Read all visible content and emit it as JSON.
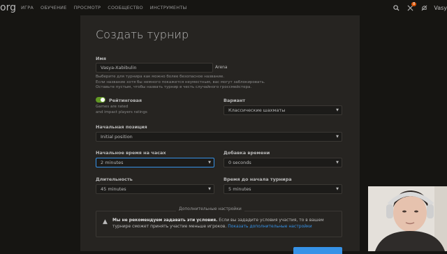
{
  "header": {
    "logo": "org",
    "nav": [
      "ИГРА",
      "ОБУЧЕНИЕ",
      "ПРОСМОТР",
      "СООБЩЕСТВО",
      "ИНСТРУМЕНТЫ"
    ],
    "badge_count": "8",
    "username": "Vasy"
  },
  "form": {
    "title": "Создать турнир",
    "name_label": "Имя",
    "name_value": "Vasya-Xabibulin",
    "name_suffix": "Arena",
    "name_hint": [
      "Выберите для турнира как можно более безопасное название.",
      "Если название хотя бы немного покажется неуместным, вас могут заблокировать.",
      "Оставьте пустым, чтобы назвать турнир в честь случайного гроссмейстера."
    ],
    "rated_label": "Рейтинговая",
    "rated_hint": [
      "Games are rated",
      "and impact players ratings"
    ],
    "variant_label": "Вариант",
    "variant_value": "Классические шахматы",
    "position_label": "Начальная позиция",
    "position_value": "Initial position",
    "clock_label": "Начальное время на часах",
    "clock_value": "2 minutes",
    "increment_label": "Добавка времени",
    "increment_value": "0 seconds",
    "duration_label": "Длительность",
    "duration_value": "45 minutes",
    "start_label": "Время до начала турнира",
    "start_value": "5 minutes",
    "advanced_legend": "Дополнительные настройки",
    "warning_bold": "Мы не рекомендуем задавать эти условия.",
    "warning_text": " Если вы зададите условия участия, то в вашем турнире сможет принять участие меньше игроков. ",
    "warning_link": "Показать дополнительные настройки"
  },
  "colors": {
    "accent": "#3692e7",
    "toggle_on": "#629924",
    "badge": "#d85000"
  }
}
